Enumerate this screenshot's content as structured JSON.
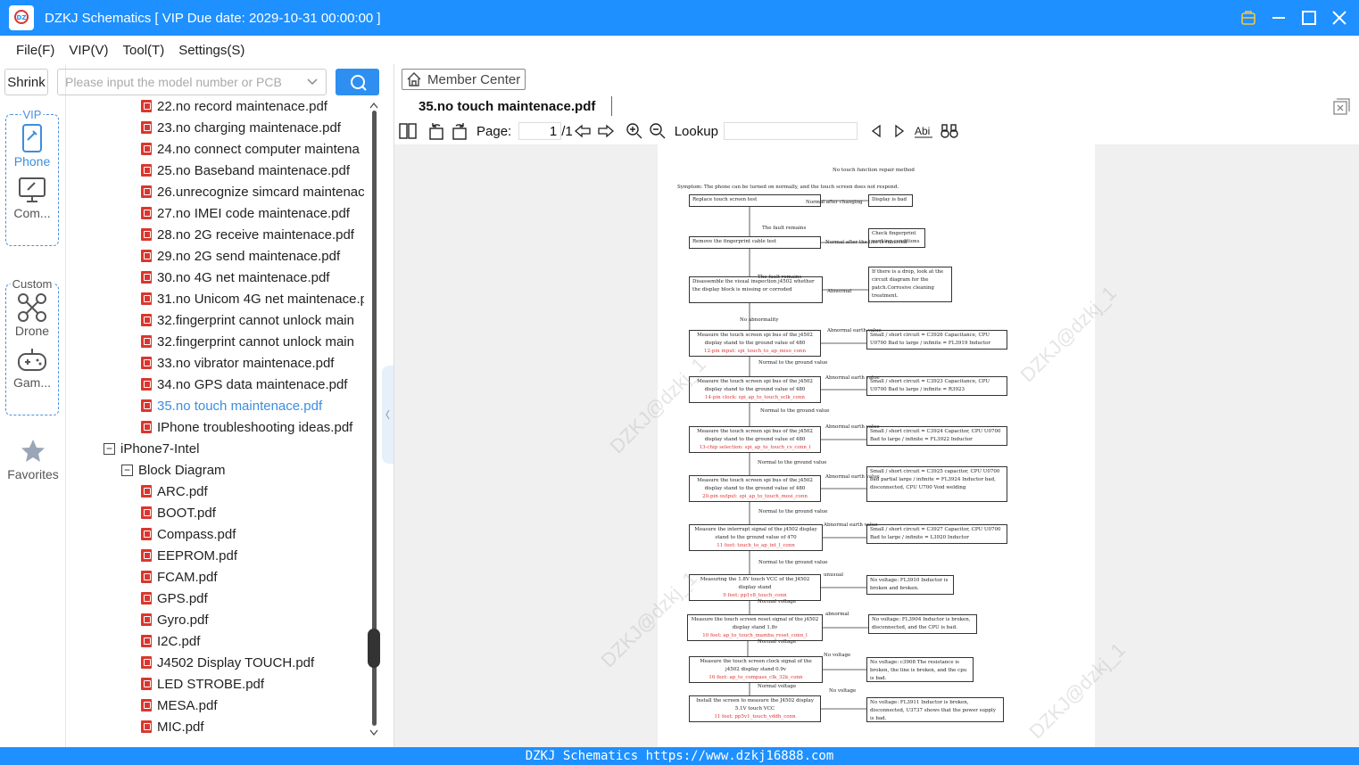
{
  "window": {
    "title": "DZKJ Schematics [ VIP Due date: 2029-10-31 00:00:00 ]"
  },
  "menu": [
    "File(F)",
    "VIP(V)",
    "Tool(T)",
    "Settings(S)"
  ],
  "rail": {
    "shrink": "Shrink",
    "vip_tag": "VIP",
    "phone": "Phone",
    "computer": "Com...",
    "custom_tag": "Custom",
    "drone": "Drone",
    "game": "Gam...",
    "favorites": "Favorites"
  },
  "search": {
    "placeholder": "Please input the model number or PCB"
  },
  "tree": {
    "files_a": [
      "22.no record maintenace.pdf",
      "23.no charging maintenace.pdf",
      "24.no connect computer maintena",
      "25.no Baseband maintenace.pdf",
      "26.unrecognize simcard maintenac",
      "27.no IMEI code maintenace.pdf",
      "28.no 2G receive maintenace.pdf",
      "29.no 2G send maintenace.pdf",
      "30.no 4G net maintenace.pdf",
      "31.no Unicom 4G net maintenace.p",
      "32.fingerprint cannot unlock main",
      "32.fingerprint cannot unlock main",
      "33.no vibrator maintenace.pdf",
      "34.no GPS data maintenace.pdf"
    ],
    "selected": "35.no touch maintenace.pdf",
    "file_after": "IPhone troubleshooting ideas.pdf",
    "folder": "iPhone7-Intel",
    "subfolder": "Block Diagram",
    "files_b": [
      "ARC.pdf",
      "BOOT.pdf",
      "Compass.pdf",
      "EEPROM.pdf",
      "FCAM.pdf",
      "GPS.pdf",
      "Gyro.pdf",
      "I2C.pdf",
      "J4502 Display TOUCH.pdf",
      "LED STROBE.pdf",
      "MESA.pdf",
      "MIC.pdf"
    ]
  },
  "viewer": {
    "member_center": "Member Center",
    "tab": "35.no touch maintenace.pdf",
    "page_label": "Page:",
    "page_current": "1",
    "page_total": "/1",
    "lookup_label": "Lookup",
    "watermark": "DZKJ@dzkj_1"
  },
  "flowchart": {
    "title": "No touch function repair method",
    "symptom": "Symptom: The phone can be turned on normally, and the touch screen does not respond.",
    "boxes": [
      {
        "text": "Replace touch screen test",
        "red": ""
      },
      {
        "text": "Display is bad",
        "red": ""
      },
      {
        "text": "Remove the fingerprint cable test",
        "red": ""
      },
      {
        "text": "Check fingerprint working conditions",
        "red": ""
      },
      {
        "text": "Disassemble the visual inspection j4502 whether the display block is missing or corroded",
        "red": ""
      },
      {
        "text": "If there is a drop, look at the circuit diagram for the patch.Corrosive cleaning treatment.",
        "red": ""
      },
      {
        "text": "Measure the touch screen spi bus of the j4502 display stand to the ground value of 480",
        "red": "12-pin input: spi_touch_to_ap_miso_conn"
      },
      {
        "text": "Small / short circuit = C3926 Capacitance, CPU U0700 Bad to large / infinite = FL3919 Inductor",
        "red": ""
      },
      {
        "text": "Measure the touch screen spi bus of the j4502 display stand to the ground value of 480",
        "red": "14-pin clock: spi_ap_to_touch_sclk_conn"
      },
      {
        "text": "Small / short circuit = C3923 Capacitance, CPU U0700 Bad to large / infinite = R3923",
        "red": ""
      },
      {
        "text": "Measure the touch screen spi bus of the j4502 display stand to the ground value of 480",
        "red": "13-chip selection: spi_ap_to_touch_cs_conn_l"
      },
      {
        "text": "Small / short circuit = C3924 Capacitor, CPU U0700 Bad to large / infinite = FL3922 Inductor",
        "red": ""
      },
      {
        "text": "Measure the touch screen spi bus of the j4502 display stand to the ground value of 480",
        "red": "20-pin output: spi_ap_to_touch_mosi_conn"
      },
      {
        "text": "Small / short circuit = C3925 capacitor, CPU U0700 bad partial large / infinite = FL3924 Inductor bad, disconnected, CPU U700 Void welding",
        "red": ""
      },
      {
        "text": "Measure the interrupt signal of the j4502 display stand to the ground value of 470",
        "red": "11 feet: touch_to_ap_int_l_conn"
      },
      {
        "text": "Small / short circuit = C3927 Capacitor, CPU U0700 Bad to large / infinite = L3920 Inductor",
        "red": ""
      },
      {
        "text": "Measuring the 1.8V touch VCC of the J4502 display stand",
        "red": "9 feet: pp1v8_touch_conn"
      },
      {
        "text": "No voltage: FL3910 Inductor is broken and broken.",
        "red": ""
      },
      {
        "text": "Measure the touch screen reset signal of the j4502 display stand 1.8v",
        "red": "10 feet: ap_to_touch_mamba_reset_conn_l"
      },
      {
        "text": "No voltage: FL3904 Inductor is broken, disconnected, and the CPU is bad.",
        "red": ""
      },
      {
        "text": "Measure the touch screen clock signal of the j4502 display stand 0.9v",
        "red": "16 feet: ap_to_compass_clk_32k_conn"
      },
      {
        "text": "No voltage: c3908 The resistance is broken, the line is broken, and the cpu is bad.",
        "red": ""
      },
      {
        "text": "Install the screen to measure the J4502 display 5.1V touch VCC",
        "red": "11 feet: pp5v1_touch_vddh_conn"
      },
      {
        "text": "No voltage: FL3911 Inductor is broken, disconnected, U3737 shows that the power supply is bad.",
        "red": ""
      }
    ],
    "labels": [
      "Normal after changing",
      "The fault remains",
      "Normal after the line is removed",
      "The fault remains",
      "Abnormal",
      "No abnormality",
      "Abnormal earth value",
      "Normal to the ground value",
      "Abnormal earth value",
      "Normal to the ground value",
      "Abnormal earth value",
      "Normal to the ground value",
      "Abnormal earth value",
      "Normal to the ground value",
      "Abnormal earth value",
      "Normal to the ground value",
      "unusual",
      "Normal voltage",
      "abnormal",
      "Normal voltage",
      "No voltage",
      "Normal voltage",
      "No voltage"
    ]
  },
  "status": "DZKJ Schematics https://www.dzkj16888.com"
}
